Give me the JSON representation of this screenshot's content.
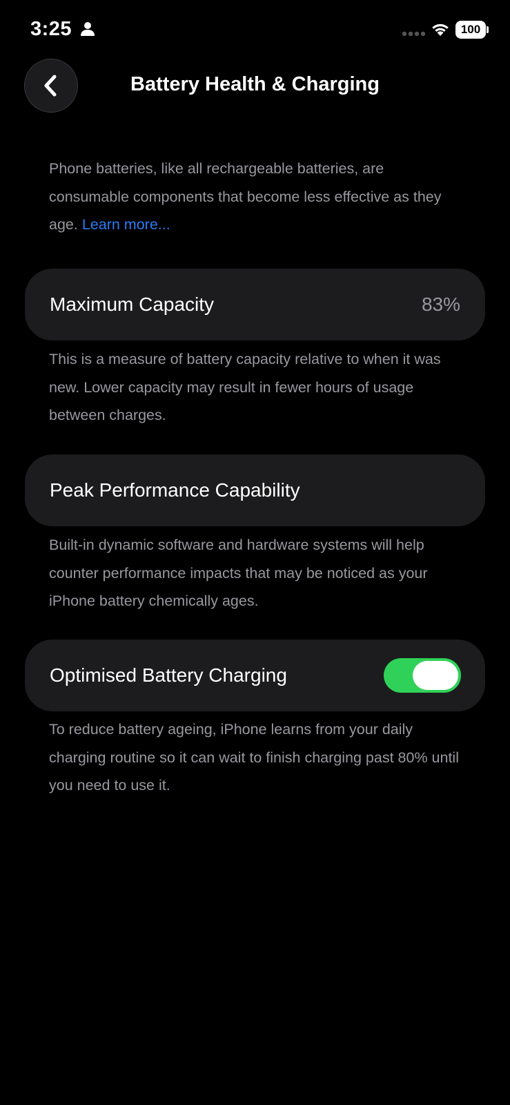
{
  "status_bar": {
    "time": "3:25",
    "battery_level": "100",
    "icons": [
      "person-icon",
      "signal-icon",
      "wifi-icon",
      "battery-icon"
    ]
  },
  "header": {
    "title": "Battery Health & Charging",
    "back_icon": "chevron-left-icon"
  },
  "intro": {
    "text": "Phone batteries, like all rechargeable batteries, are consumable components that become less effective as they age. ",
    "link_label": "Learn more..."
  },
  "maximum_capacity": {
    "label": "Maximum Capacity",
    "value": "83%",
    "description": "This is a measure of battery capacity relative to when it was new. Lower capacity may result in fewer hours of usage between charges."
  },
  "peak_performance": {
    "label": "Peak Performance Capability",
    "description": "Built-in dynamic software and hardware systems will help counter performance impacts that may be noticed as your iPhone battery chemically ages."
  },
  "optimised_charging": {
    "label": "Optimised Battery Charging",
    "enabled": true,
    "description": "To reduce battery ageing, iPhone learns from your daily charging routine so it can wait to finish charging past 80% until you need to use it."
  },
  "colors": {
    "background": "#000000",
    "card": "#1c1c1e",
    "secondary_text": "#98989f",
    "link": "#2b7bf5",
    "toggle_on": "#30d158"
  }
}
